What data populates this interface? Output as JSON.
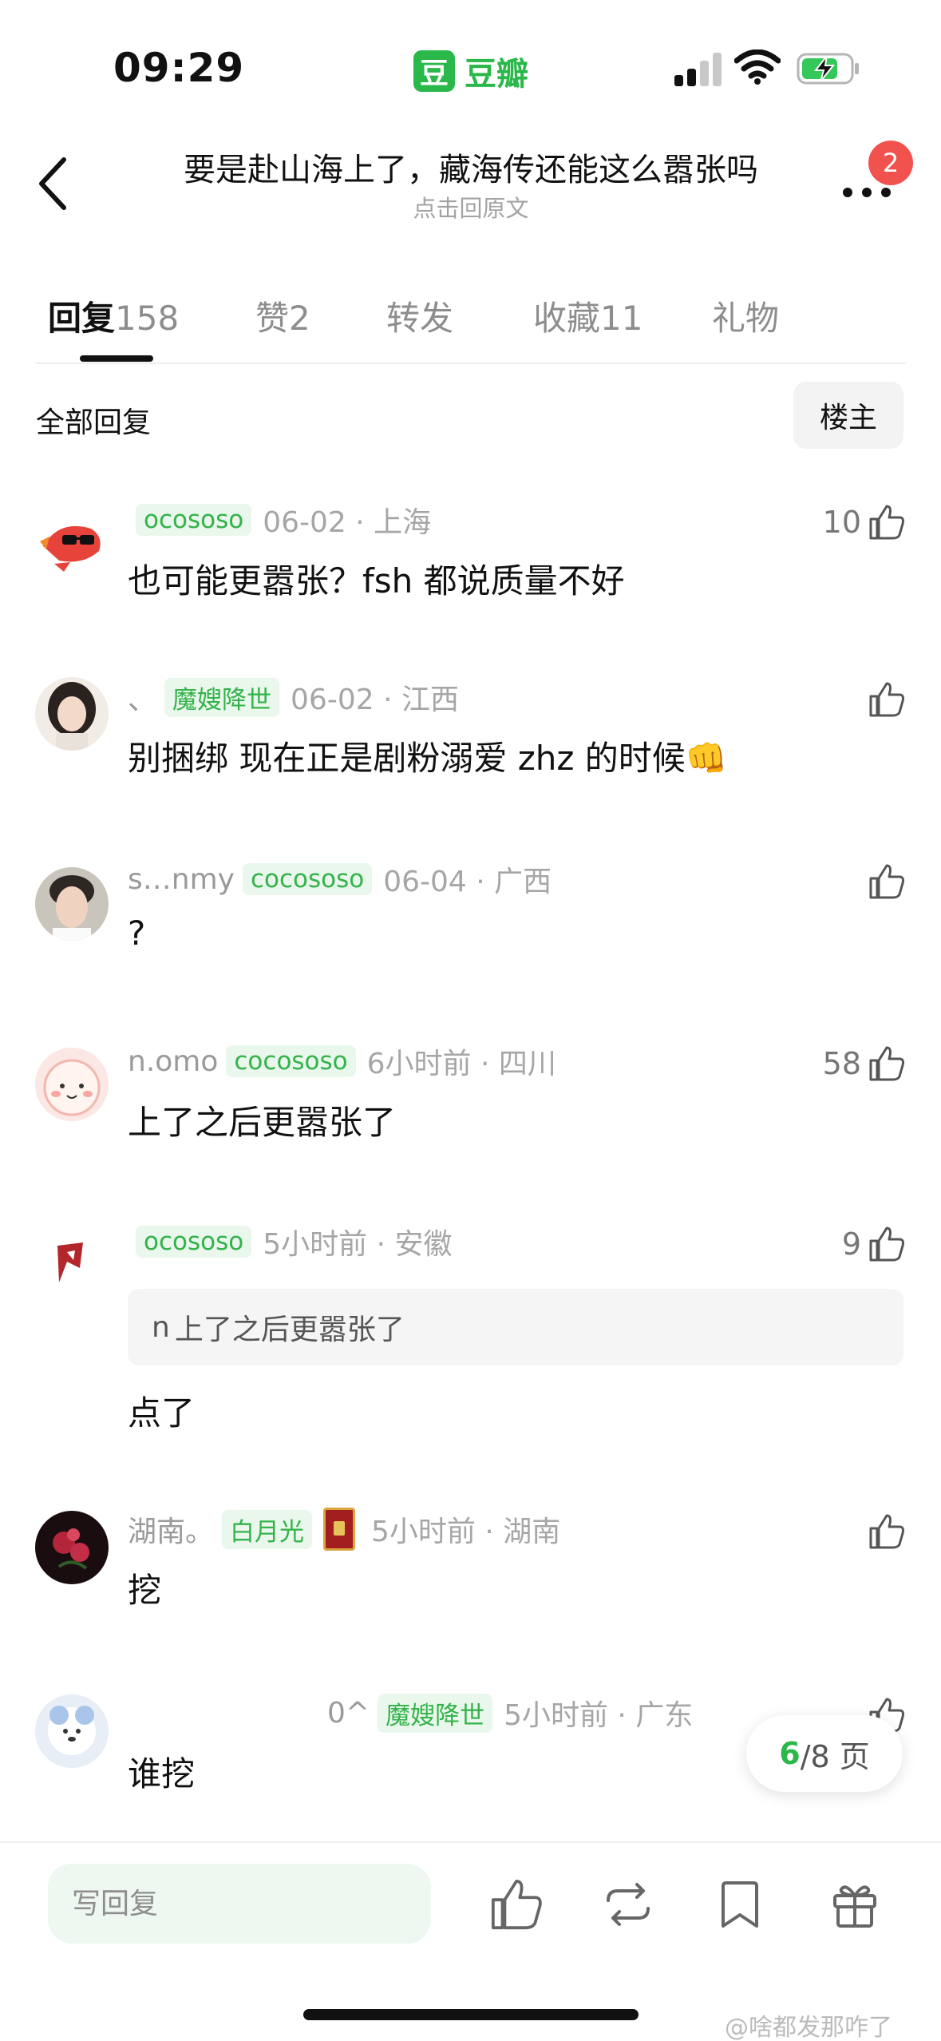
{
  "status_bar": {
    "time": "09:29",
    "app_name": "豆瓣",
    "app_logo_char": "豆"
  },
  "header": {
    "title": "要是赴山海上了，藏海传还能这么嚣张吗",
    "subtitle": "点击回原文",
    "notification_count": "2"
  },
  "tabs": [
    {
      "label": "回复",
      "count": "158",
      "active": true
    },
    {
      "label": "赞",
      "count": "2"
    },
    {
      "label": "转发",
      "count": ""
    },
    {
      "label": "收藏",
      "count": "11"
    },
    {
      "label": "礼物",
      "count": ""
    }
  ],
  "filter": {
    "all_label": "全部回复",
    "op_label": "楼主"
  },
  "comments": [
    {
      "username": "",
      "tag": "ocososo",
      "date_loc": "06-02 · 上海",
      "likes": "10",
      "text": "也可能更嚣张？fsh 都说质量不好"
    },
    {
      "username": "、",
      "tag": "魔嫂降世",
      "date_loc": "06-02 · 江西",
      "likes": "",
      "text": "别捆绑 现在正是剧粉溺爱 zhz 的时候👊"
    },
    {
      "username": "s…nmy",
      "tag": "cocososo",
      "date_loc": "06-04 · 广西",
      "likes": "",
      "text": "?"
    },
    {
      "username": "n.omo",
      "tag": "cocososo",
      "date_loc": "6小时前 · 四川",
      "likes": "58",
      "text": "上了之后更嚣张了"
    },
    {
      "username": "",
      "tag": "ocososo",
      "date_loc": "5小时前 · 安徽",
      "likes": "9",
      "quote_user": "n",
      "quote_text": "上了之后更嚣张了",
      "text": "点了"
    },
    {
      "username": "湖南。",
      "tag": "白月光",
      "date_loc": "5小时前 · 湖南",
      "likes": "",
      "text": "挖"
    },
    {
      "username": "0^",
      "tag": "魔嫂降世",
      "date_loc": "5小时前 · 广东",
      "likes": "",
      "text": "谁挖"
    }
  ],
  "pager": {
    "current": "6",
    "total_text": "/8 页"
  },
  "bottom_bar": {
    "reply_placeholder": "写回复"
  },
  "watermark": "@啥都发那咋了",
  "colors": {
    "brand_green": "#2bb84a",
    "tag_green": "#33b349",
    "badge_red": "#f2524e"
  }
}
